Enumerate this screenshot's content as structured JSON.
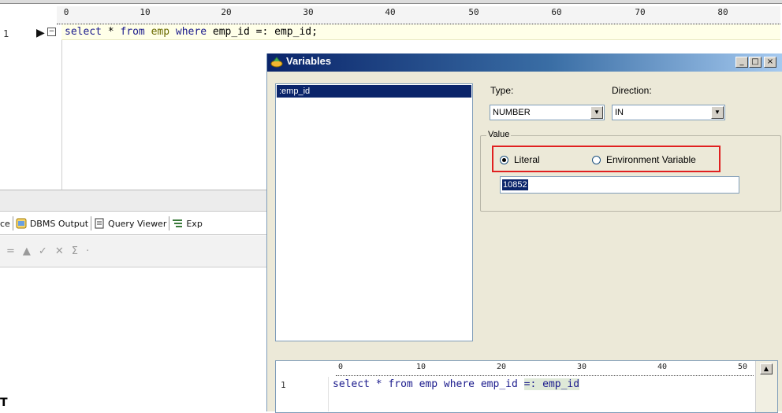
{
  "editor": {
    "ruler_numbers": [
      "0",
      "10",
      "20",
      "30",
      "40",
      "50",
      "60",
      "70",
      "80"
    ],
    "line_number": "1",
    "code": {
      "kw1": "select",
      "star": " * ",
      "kw2": "from",
      "table": " emp ",
      "kw3": "where",
      "rest": " emp_id =: emp_id;"
    }
  },
  "bottom_panel": {
    "tabs": [
      {
        "label": "ce",
        "icon": "none"
      },
      {
        "label": "DBMS Output",
        "icon": "dbms-output-icon"
      },
      {
        "label": "Query Viewer",
        "icon": "document-icon"
      },
      {
        "label": "Exp",
        "icon": "explain-plan-icon"
      }
    ],
    "toolbar_symbols": [
      "=",
      "▲",
      "✓",
      "✕",
      "Σ",
      "·"
    ]
  },
  "caret_text": "T",
  "dialog": {
    "title": "Variables",
    "controls": {
      "minimize": "_",
      "maximize": "□",
      "close": "×"
    },
    "variables": [
      ":emp_id"
    ],
    "type_label": "Type:",
    "type_value": "NUMBER",
    "direction_label": "Direction:",
    "direction_value": "IN",
    "value_group_label": "Value",
    "literal_label": "Literal",
    "env_var_label": "Environment Variable",
    "selected_radio": "Literal",
    "value_input": "10852",
    "highlight_color": "#e02020",
    "preview": {
      "ruler_numbers": [
        "0",
        "10",
        "20",
        "30",
        "40",
        "50"
      ],
      "line_number": "1",
      "code_before": "select * from emp where emp_id ",
      "code_highlight": "=: emp_id"
    }
  }
}
